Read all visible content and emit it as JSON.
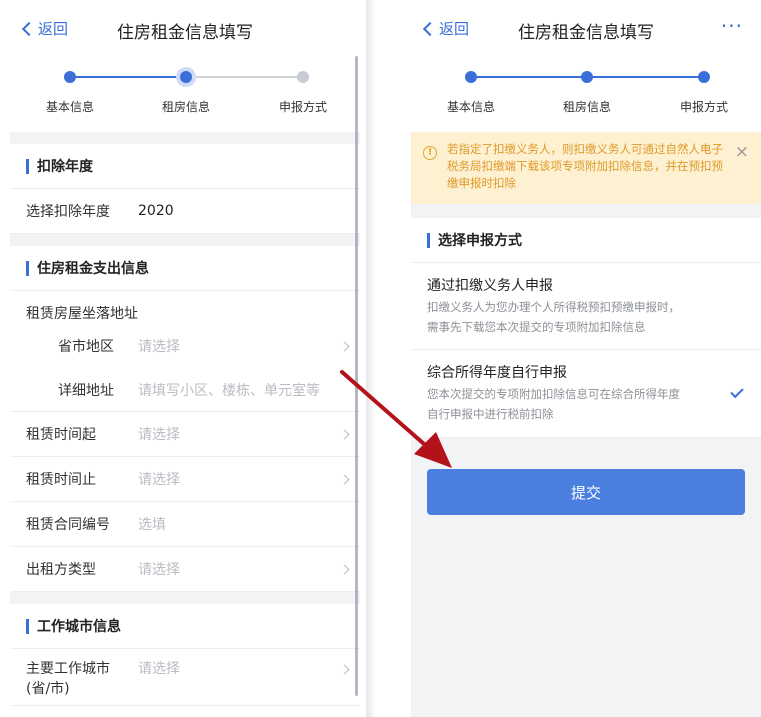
{
  "left": {
    "back_label": "返回",
    "title": "住房租金信息填写",
    "steps": [
      "基本信息",
      "租房信息",
      "申报方式"
    ],
    "section_deduction": "扣除年度",
    "deduction_year_label": "选择扣除年度",
    "deduction_year_value": "2020",
    "section_rent": "住房租金支出信息",
    "address_label": "租赁房屋坐落地址",
    "region_label": "省市地区",
    "region_placeholder": "请选择",
    "detail_label": "详细地址",
    "detail_placeholder": "请填写小区、楼栋、单元室等",
    "start_label": "租赁时间起",
    "start_placeholder": "请选择",
    "end_label": "租赁时间止",
    "end_placeholder": "请选择",
    "contract_label": "租赁合同编号",
    "contract_placeholder": "选填",
    "landlord_label": "出租方类型",
    "landlord_placeholder": "请选择",
    "section_city": "工作城市信息",
    "city_label_line1": "主要工作城市",
    "city_label_line2": "(省/市)",
    "city_placeholder": "请选择"
  },
  "right": {
    "back_label": "返回",
    "title": "住房租金信息填写",
    "more_label": "···",
    "steps": [
      "基本信息",
      "租房信息",
      "申报方式"
    ],
    "notice_text": "若指定了扣缴义务人，则扣缴义务人可通过自然人电子税务局扣缴端下载该项专项附加扣除信息，并在预扣预缴申报时扣除",
    "notice_close": "×",
    "section_method": "选择申报方式",
    "option1_title": "通过扣缴义务人申报",
    "option1_desc_line1": "扣缴义务人为您办理个人所得税预扣预缴申报时，",
    "option1_desc_line2": "需事先下载您本次提交的专项附加扣除信息",
    "option2_title": "综合所得年度自行申报",
    "option2_desc_line1": "您本次提交的专项附加扣除信息可在综合所得年度",
    "option2_desc_line2": "自行申报中进行税前扣除",
    "submit_label": "提交"
  },
  "colors": {
    "accent": "#3b6fd8",
    "notice_bg": "#fdf1d2",
    "notice_text": "#e09a2a",
    "arrow": "#b3121b"
  }
}
